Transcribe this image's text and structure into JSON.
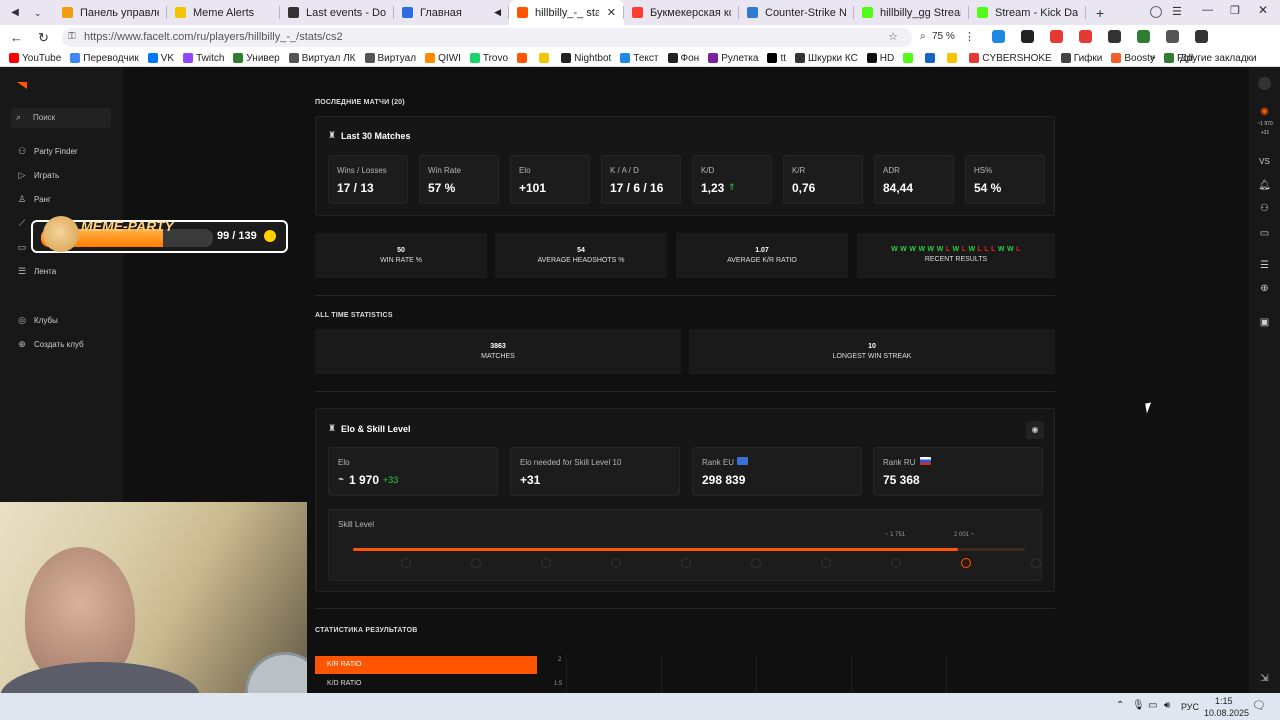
{
  "browser": {
    "tabs": [
      {
        "label": "Панель управления",
        "fav": "#f39c12"
      },
      {
        "label": "Meme Alerts",
        "fav": "#f5c400"
      },
      {
        "label": "Last events - Donate",
        "fav": "#333333"
      },
      {
        "label": "Главная",
        "fav": "#2d6cdf"
      },
      {
        "label": "hillbilly_-_ stats - FA",
        "fav": "#ff5500"
      },
      {
        "label": "Букмекерская конто",
        "fav": "#ff3b30"
      },
      {
        "label": "Counter-Strike News",
        "fav": "#2e7bcf"
      },
      {
        "label": "hillbilly_gg Stream - W",
        "fav": "#53fc18"
      },
      {
        "label": "Stream - Kick Dashbo",
        "fav": "#53fc18"
      }
    ],
    "url": "https://www.facelt.com/ru/players/hillbilly_-_/stats/cs2",
    "zoom": "75 %",
    "bookmarks": [
      {
        "label": "YouTube",
        "ic": "#ff0000"
      },
      {
        "label": "Переводчик",
        "ic": "#4285f4"
      },
      {
        "label": "VK",
        "ic": "#0077ff"
      },
      {
        "label": "Twitch",
        "ic": "#9146ff"
      },
      {
        "label": "Универ",
        "ic": "#2e7d32"
      },
      {
        "label": "Виртуал ЛК",
        "ic": "#555555"
      },
      {
        "label": "Виртуал",
        "ic": "#555555"
      },
      {
        "label": "QIWI",
        "ic": "#ff8c00"
      },
      {
        "label": "Trovo",
        "ic": "#19d66b"
      },
      {
        "label": "",
        "ic": "#ff5500"
      },
      {
        "label": "",
        "ic": "#f5c400"
      },
      {
        "label": "Nightbot",
        "ic": "#222222"
      },
      {
        "label": "Текст",
        "ic": "#1e88e5"
      },
      {
        "label": "Фон",
        "ic": "#222222"
      },
      {
        "label": "Рулетка",
        "ic": "#7b1fa2"
      },
      {
        "label": "tt",
        "ic": "#000000"
      },
      {
        "label": "Шкурки КС",
        "ic": "#333333"
      },
      {
        "label": "HD",
        "ic": "#111111"
      },
      {
        "label": "",
        "ic": "#53fc18"
      },
      {
        "label": "",
        "ic": "#1565c0"
      },
      {
        "label": "",
        "ic": "#f5c400"
      },
      {
        "label": "CYBERSHOKE",
        "ic": "#e53935"
      },
      {
        "label": "Гифки",
        "ic": "#444444"
      },
      {
        "label": "Boosty",
        "ic": "#f15f2c"
      },
      {
        "label": "Foll",
        "ic": "#2e7d32"
      }
    ],
    "other_bookmarks": "Другие закладки"
  },
  "sidebar": {
    "search": "Поиск",
    "items": [
      "Party Finder",
      "Играть",
      "Ранг",
      "",
      "",
      "Лента"
    ],
    "clubs": "Клубы",
    "create_club": "Создать клуб"
  },
  "overlay": {
    "title": "MEME-PARTY",
    "progress": "99 / 139",
    "fill": 0.712
  },
  "main": {
    "recent_title": "ПОСЛЕДНИЕ МАТЧИ (20)",
    "last30_title": "Last 30 Matches",
    "last30": [
      {
        "label": "Wins / Losses",
        "value": "17 / 13"
      },
      {
        "label": "Win Rate",
        "value": "57 %"
      },
      {
        "label": "Elo",
        "value": "+101"
      },
      {
        "label": "K / A / D",
        "value": "17 / 6 / 16"
      },
      {
        "label": "K/D",
        "value": "1,23"
      },
      {
        "label": "K/R",
        "value": "0,76"
      },
      {
        "label": "ADR",
        "value": "84,44"
      },
      {
        "label": "HS%",
        "value": "54 %"
      }
    ],
    "summary": [
      {
        "num": "50",
        "text": "WIN RATE %"
      },
      {
        "num": "54",
        "text": "AVERAGE HEADSHOTS %"
      },
      {
        "num": "1.07",
        "text": "AVERAGE K/R RATIO"
      }
    ],
    "recent_results": [
      "W",
      "W",
      "W",
      "W",
      "W",
      "W",
      "L",
      "W",
      "L",
      "W",
      "L",
      "L",
      "L",
      "W",
      "W",
      "L"
    ],
    "recent_results_label": "RECENT RESULTS",
    "alltime_title": "ALL TIME STATISTICS",
    "alltime": [
      {
        "num": "3863",
        "text": "MATCHES"
      },
      {
        "num": "10",
        "text": "LONGEST WIN STREAK"
      }
    ],
    "elo_title": "Elo & Skill Level",
    "elo_tiles": [
      {
        "label": "Elo",
        "value": "1 970",
        "extra": "+33"
      },
      {
        "label": "Elo needed for Skill Level 10",
        "value": "+31",
        "extra": ""
      },
      {
        "label": "Rank EU",
        "value": "298 839",
        "extra": ""
      },
      {
        "label": "Rank RU",
        "value": "75 368",
        "extra": ""
      }
    ],
    "skill_label": "Skill Level",
    "skill_marker_a": "1 751",
    "skill_marker_b": "2 001",
    "skill_fill": 0.9,
    "results_title": "СТАТИСТИКА РЕЗУЛЬТАТОВ",
    "result_tabs": [
      "K/R RATIO",
      "K/D RATIO"
    ],
    "chart_ticks": [
      "2",
      "1.5"
    ]
  },
  "taskbar": {
    "lang": "РУС",
    "time": "1:15",
    "date": "10.08.2025"
  },
  "colors": {
    "accent": "#ff5500",
    "win": "#2ecc40",
    "loss": "#e02020"
  }
}
